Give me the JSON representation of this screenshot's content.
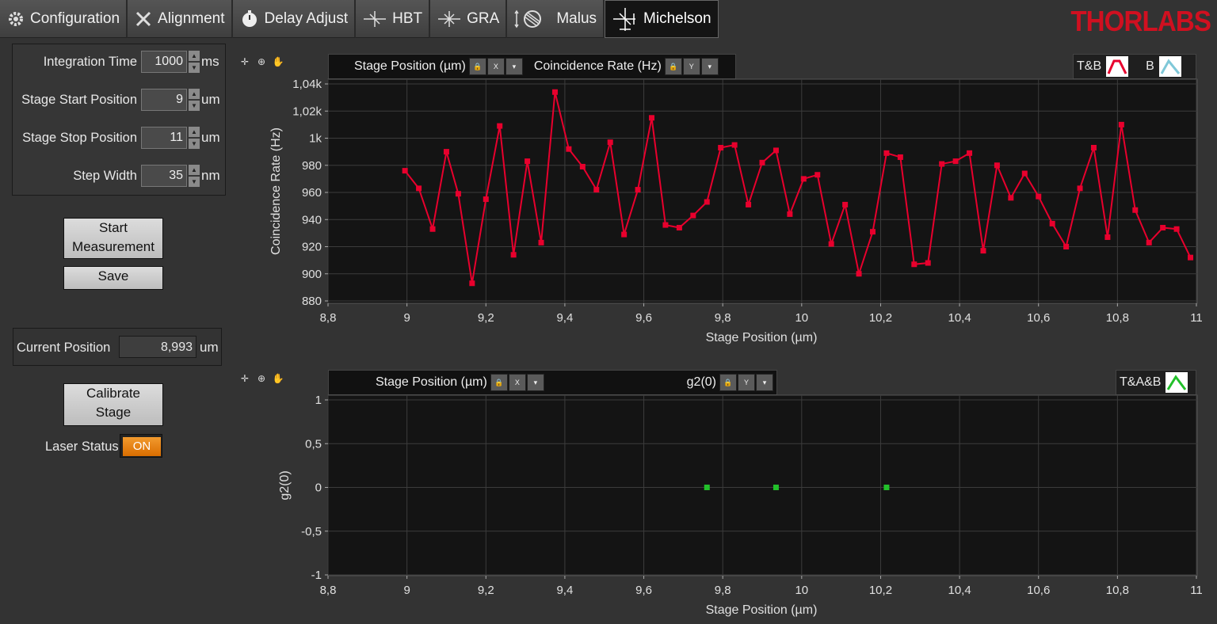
{
  "tabs": [
    {
      "label": "Configuration",
      "icon": "gear-icon"
    },
    {
      "label": "Alignment",
      "icon": "tools-icon"
    },
    {
      "label": "Delay Adjust",
      "icon": "stopwatch-icon"
    },
    {
      "label": "HBT",
      "icon": "beam-splitter-icon"
    },
    {
      "label": "GRA",
      "icon": "grating-icon"
    },
    {
      "label": "Malus",
      "icon": "polarizer-icon"
    },
    {
      "label": "Michelson",
      "icon": "interferometer-icon",
      "active": true
    }
  ],
  "logo": "THORLABS",
  "settings": {
    "integration_time": {
      "label": "Integration Time",
      "value": "1000",
      "unit": "ms"
    },
    "stage_start": {
      "label": "Stage Start Position",
      "value": "9",
      "unit": "um"
    },
    "stage_stop": {
      "label": "Stage Stop Position",
      "value": "11",
      "unit": "um"
    },
    "step_width": {
      "label": "Step Width",
      "value": "35",
      "unit": "nm"
    }
  },
  "buttons": {
    "start_line1": "Start",
    "start_line2": "Measurement",
    "save": "Save",
    "calibrate_line1": "Calibrate",
    "calibrate_line2": "Stage"
  },
  "current_position": {
    "label": "Current Position",
    "value": "8,993",
    "unit": "um"
  },
  "laser": {
    "label": "Laser Status",
    "state": "ON",
    "color": "#e8820e"
  },
  "colors": {
    "accent": "#e8002d",
    "green": "#22c02a",
    "logo": "#d01020"
  },
  "graph1": {
    "x_scale_label": "Stage Position (µm)",
    "y_scale_label": "Coincidence Rate (Hz)",
    "legend": [
      "T&B",
      "B"
    ]
  },
  "graph2": {
    "x_scale_label": "Stage Position (µm)",
    "y_scale_label": "g2(0)",
    "legend": [
      "T&A&B"
    ]
  },
  "chart_data": [
    {
      "type": "line",
      "xlabel": "Stage Position (µm)",
      "ylabel": "Coincidence Rate (Hz)",
      "xlim": [
        8.8,
        11
      ],
      "ylim": [
        880,
        1040
      ],
      "x_ticks": [
        "8,8",
        "9",
        "9,2",
        "9,4",
        "9,6",
        "9,8",
        "10",
        "10,2",
        "10,4",
        "10,6",
        "10,8",
        "11"
      ],
      "y_ticks": [
        "880",
        "900",
        "920",
        "940",
        "960",
        "980",
        "1k",
        "1,02k",
        "1,04k"
      ],
      "grid": true,
      "legend_position": "top-right",
      "series": [
        {
          "name": "T&B",
          "color": "#e8002d",
          "x": [
            8.995,
            9.03,
            9.065,
            9.1,
            9.13,
            9.165,
            9.2,
            9.235,
            9.27,
            9.305,
            9.34,
            9.375,
            9.41,
            9.445,
            9.48,
            9.515,
            9.55,
            9.585,
            9.62,
            9.655,
            9.69,
            9.725,
            9.76,
            9.795,
            9.83,
            9.865,
            9.9,
            9.935,
            9.97,
            10.005,
            10.04,
            10.075,
            10.11,
            10.145,
            10.18,
            10.215,
            10.25,
            10.285,
            10.32,
            10.355,
            10.39,
            10.425,
            10.46,
            10.495,
            10.53,
            10.565,
            10.6,
            10.635,
            10.67,
            10.705,
            10.74,
            10.775,
            10.81,
            10.845,
            10.88,
            10.915,
            10.95,
            10.985
          ],
          "y": [
            976,
            963,
            933,
            990,
            959,
            893,
            955,
            1009,
            914,
            983,
            923,
            1034,
            992,
            979,
            962,
            997,
            929,
            962,
            1015,
            936,
            934,
            943,
            953,
            993,
            995,
            951,
            982,
            991,
            944,
            970,
            973,
            922,
            951,
            900,
            931,
            989,
            986,
            907,
            908,
            981,
            983,
            989,
            917,
            980,
            956,
            974,
            957,
            937,
            920,
            963,
            993,
            927,
            1010,
            947,
            923,
            934,
            933,
            912
          ]
        }
      ]
    },
    {
      "type": "scatter",
      "xlabel": "Stage Position (µm)",
      "ylabel": "g2(0)",
      "xlim": [
        8.8,
        11
      ],
      "ylim": [
        -1,
        1
      ],
      "x_ticks": [
        "8,8",
        "9",
        "9,2",
        "9,4",
        "9,6",
        "9,8",
        "10",
        "10,2",
        "10,4",
        "10,6",
        "10,8",
        "11"
      ],
      "y_ticks": [
        "-1",
        "-0,5",
        "0",
        "0,5",
        "1"
      ],
      "grid": true,
      "legend_position": "top-right",
      "series": [
        {
          "name": "T&A&B",
          "color": "#22c02a",
          "x": [
            9.76,
            9.935,
            10.215
          ],
          "y": [
            0,
            0,
            0
          ]
        }
      ]
    }
  ]
}
